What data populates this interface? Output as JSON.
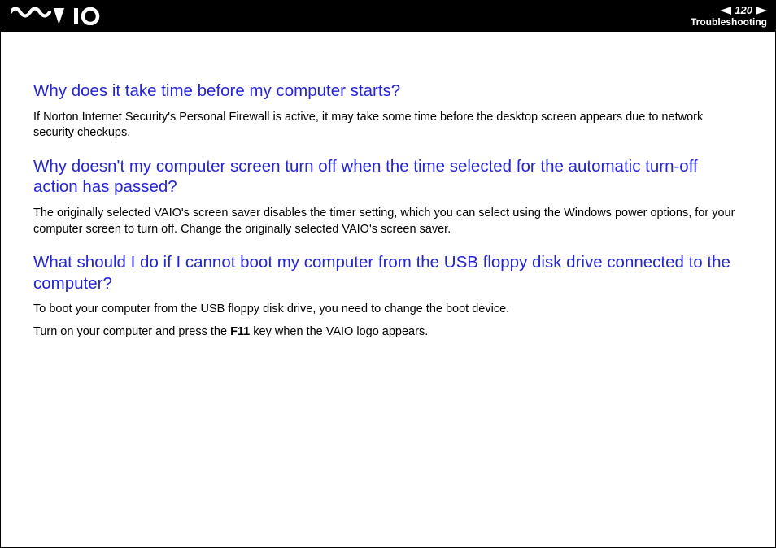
{
  "header": {
    "page_number": "120",
    "section": "Troubleshooting"
  },
  "sections": [
    {
      "heading": "Why does it take time before my computer starts?",
      "paras": [
        "If Norton Internet Security's Personal Firewall is active, it may take some time before the desktop screen appears due to network security checkups."
      ]
    },
    {
      "heading": "Why doesn't my computer screen turn off when the time selected for the automatic turn-off action has passed?",
      "paras": [
        "The originally selected VAIO's screen saver disables the timer setting, which you can select using the Windows power options, for your computer screen to turn off.\nChange the originally selected VAIO's screen saver."
      ]
    },
    {
      "heading": "What should I do if I cannot boot my computer from the USB floppy disk drive connected to the computer?",
      "paras": [
        "To boot your computer from the USB floppy disk drive, you need to change the boot device.",
        "Turn on your computer and press the <b>F11</b> key when the VAIO logo appears."
      ]
    }
  ]
}
